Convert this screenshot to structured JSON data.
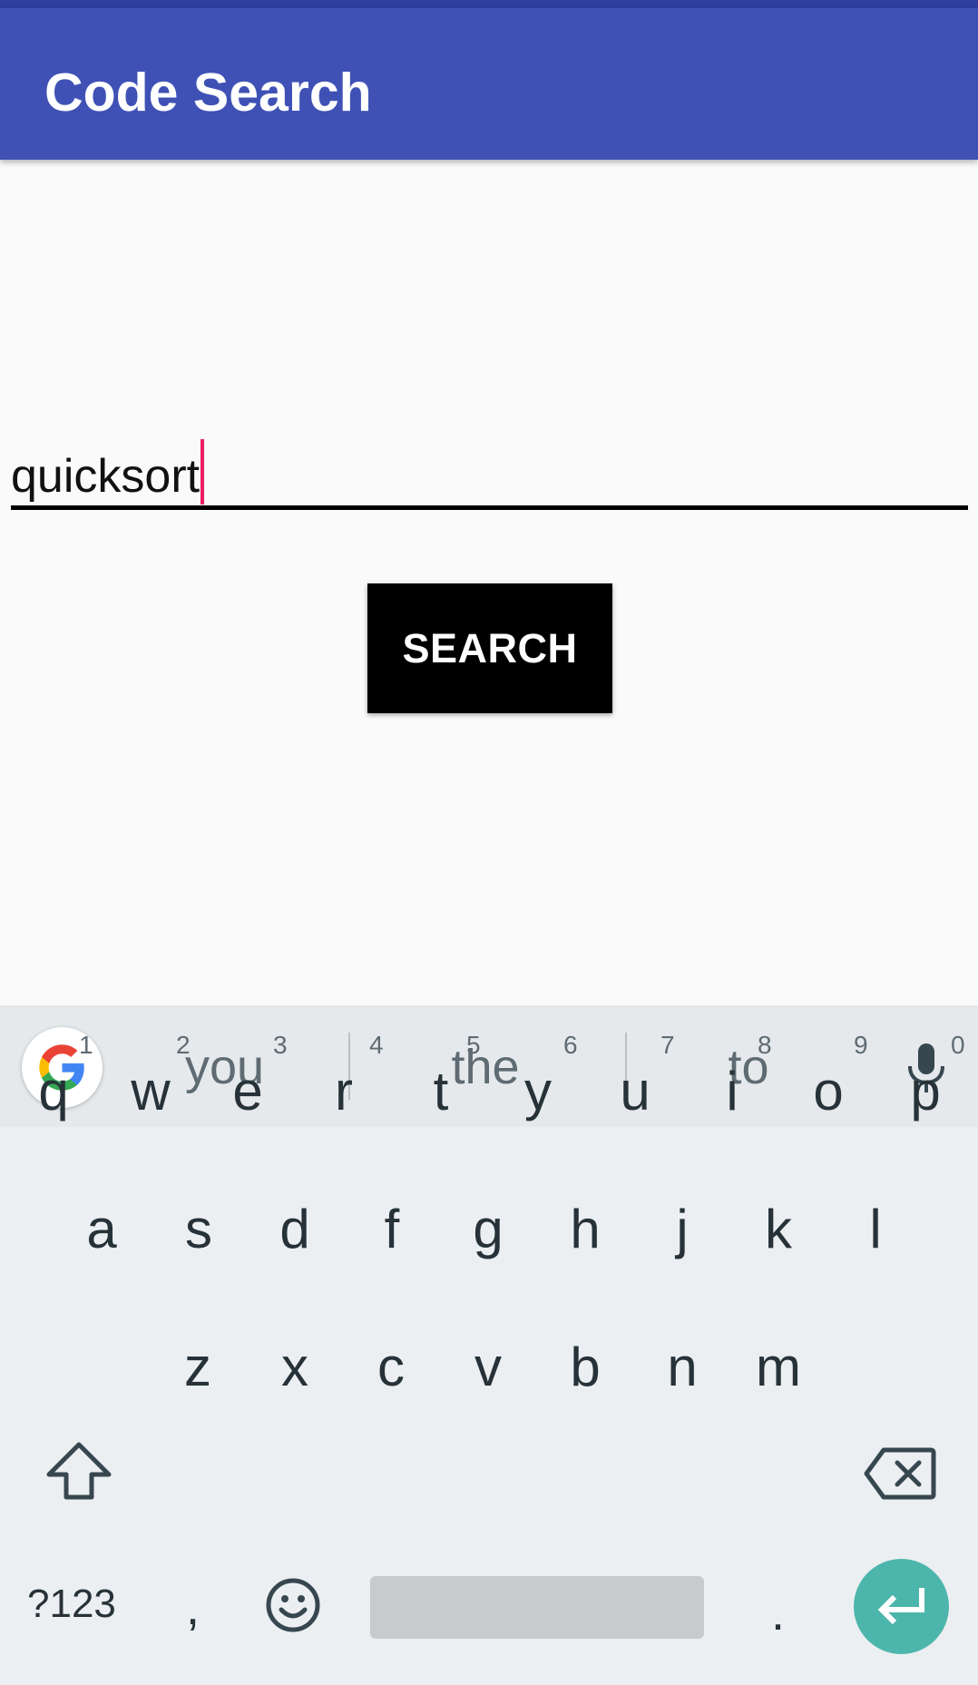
{
  "app_bar": {
    "title": "Code Search",
    "color": "#3f51b5"
  },
  "search": {
    "value": "quicksort",
    "button_label": "SEARCH"
  },
  "keyboard": {
    "suggestions": [
      "you",
      "the",
      "to"
    ],
    "row1": [
      {
        "letter": "q",
        "hint": "1"
      },
      {
        "letter": "w",
        "hint": "2"
      },
      {
        "letter": "e",
        "hint": "3"
      },
      {
        "letter": "r",
        "hint": "4"
      },
      {
        "letter": "t",
        "hint": "5"
      },
      {
        "letter": "y",
        "hint": "6"
      },
      {
        "letter": "u",
        "hint": "7"
      },
      {
        "letter": "i",
        "hint": "8"
      },
      {
        "letter": "o",
        "hint": "9"
      },
      {
        "letter": "p",
        "hint": "0"
      }
    ],
    "row2": [
      "a",
      "s",
      "d",
      "f",
      "g",
      "h",
      "j",
      "k",
      "l"
    ],
    "row3": [
      "z",
      "x",
      "c",
      "v",
      "b",
      "n",
      "m"
    ],
    "symbols_label": "?123",
    "comma": ",",
    "period": ".",
    "icons": {
      "google": "google-logo-icon",
      "mic": "mic-icon",
      "shift": "shift-icon",
      "backspace": "backspace-icon",
      "emoji": "emoji-icon",
      "enter": "enter-icon"
    },
    "enter_color": "#4db6ac"
  }
}
